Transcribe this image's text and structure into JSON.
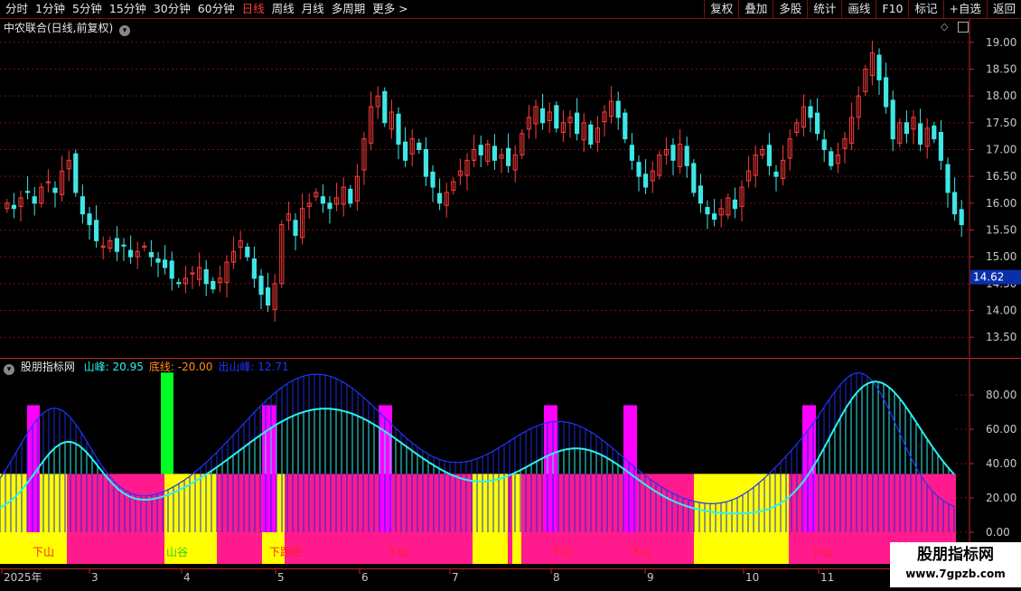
{
  "toolbar": {
    "periods": [
      "分时",
      "1分钟",
      "5分钟",
      "15分钟",
      "30分钟",
      "60分钟",
      "日线",
      "周线",
      "月线",
      "多周期",
      "更多 >"
    ],
    "active_period": "日线",
    "actions": [
      "复权",
      "叠加",
      "多股",
      "统计",
      "画线",
      "F10",
      "标记",
      "+自选",
      "返回"
    ]
  },
  "main_panel": {
    "title": "中农联合(日线,前复权)",
    "y_ticks": [
      "19.00",
      "18.50",
      "18.00",
      "17.50",
      "17.00",
      "16.50",
      "16.00",
      "15.50",
      "15.00",
      "14.50",
      "14.00",
      "13.50"
    ],
    "current_price": "14.62"
  },
  "indicator_panel": {
    "name": "股朋指标网",
    "values": [
      {
        "label": "山峰:",
        "value": "20.95",
        "color": "#2cf0f0"
      },
      {
        "label": "底线:",
        "value": "-20.00",
        "color": "#ff8c1a"
      },
      {
        "label": "出山峰:",
        "value": "12.71",
        "color": "#2233ff"
      }
    ],
    "y_ticks": [
      "80.00",
      "60.00",
      "40.00",
      "20.00",
      "0.00"
    ],
    "phase_labels": [
      "下山",
      "山谷",
      "下跑吧",
      "下山",
      "下山",
      "下山",
      "下山"
    ]
  },
  "x_axis": {
    "labels": [
      "2025年",
      "3",
      "4",
      "5",
      "6",
      "7",
      "8",
      "9",
      "10",
      "11"
    ]
  },
  "watermark": {
    "title": "股朋指标网",
    "url": "www.7gpzb.com"
  },
  "colors": {
    "up": "#ff3b3b",
    "down": "#3ee6e6",
    "grid": "#7a1010",
    "pink": "#ff1b8d",
    "yellow": "#ffff00",
    "magenta": "#ff00ff",
    "green": "#00ff22",
    "cyan": "#2cf0f0",
    "blue": "#2233ff",
    "orange": "#ff8c1a"
  },
  "chart_data": {
    "type": "candlestick",
    "title": "中农联合(日线,前复权)",
    "y_range": [
      13.2,
      19.3
    ],
    "last_price": 14.62,
    "close_series": [
      16.0,
      15.9,
      16.1,
      16.2,
      16.0,
      16.3,
      16.4,
      16.2,
      16.6,
      16.8,
      16.2,
      15.8,
      15.6,
      15.3,
      15.2,
      15.3,
      15.1,
      15.2,
      15.0,
      15.1,
      15.2,
      15.0,
      14.9,
      14.8,
      14.6,
      14.5,
      14.6,
      14.7,
      14.8,
      14.5,
      14.4,
      14.6,
      14.9,
      15.1,
      15.3,
      15.0,
      14.6,
      14.3,
      14.1,
      14.5,
      15.6,
      15.8,
      15.4,
      15.9,
      16.0,
      16.2,
      16.0,
      15.9,
      16.1,
      16.3,
      16.0,
      16.5,
      17.2,
      17.8,
      18.0,
      17.5,
      17.7,
      17.1,
      16.8,
      17.2,
      17.0,
      16.5,
      16.3,
      16.0,
      16.2,
      16.4,
      16.6,
      16.8,
      17.0,
      16.9,
      17.1,
      16.8,
      16.9,
      16.7,
      16.9,
      17.3,
      17.6,
      17.8,
      17.5,
      17.7,
      17.4,
      17.5,
      17.6,
      17.3,
      17.5,
      17.1,
      17.4,
      17.7,
      17.9,
      17.6,
      17.2,
      16.8,
      16.5,
      16.3,
      16.6,
      16.9,
      17.0,
      16.8,
      17.1,
      16.7,
      16.2,
      16.0,
      15.8,
      15.7,
      15.9,
      16.1,
      15.9,
      16.3,
      16.6,
      16.9,
      17.0,
      16.7,
      16.5,
      16.8,
      17.2,
      17.5,
      17.8,
      17.6,
      17.3,
      17.0,
      16.7,
      16.9,
      17.2,
      17.6,
      18.0,
      18.5,
      18.8,
      18.3,
      17.8,
      17.2,
      17.5,
      17.3,
      17.6,
      17.1,
      17.4,
      17.2,
      16.8,
      16.2,
      15.8,
      15.6
    ]
  }
}
